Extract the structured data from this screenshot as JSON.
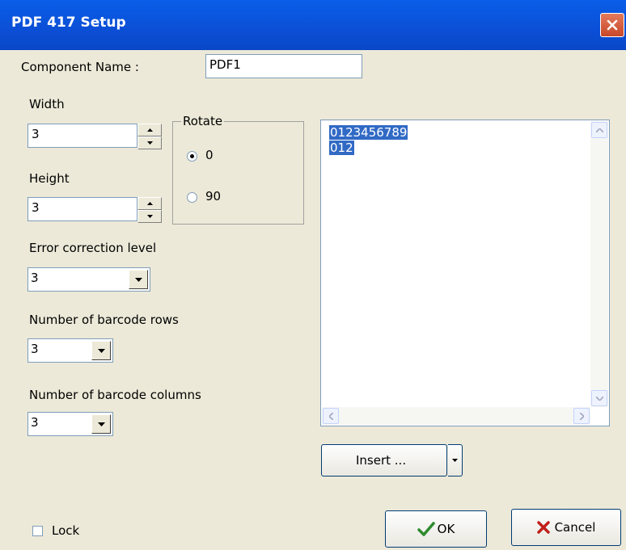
{
  "window": {
    "title": "PDF 417 Setup",
    "close_icon": "close-x-icon"
  },
  "component_name": {
    "label": "Component Name :",
    "value": "PDF1"
  },
  "width": {
    "label": "Width",
    "value": "3"
  },
  "height": {
    "label": "Height",
    "value": "3"
  },
  "rotate": {
    "label": "Rotate",
    "options": [
      {
        "label": "0",
        "selected": true
      },
      {
        "label": "90",
        "selected": false
      }
    ]
  },
  "error_correction": {
    "label": "Error correction level",
    "value": "3"
  },
  "barcode_rows": {
    "label": "Number of barcode rows",
    "value": "3"
  },
  "barcode_columns": {
    "label": "Number of barcode columns",
    "value": "3"
  },
  "memo": {
    "lines": [
      "0123456789",
      "012"
    ]
  },
  "insert_button": {
    "label": "Insert ..."
  },
  "lock": {
    "label": "Lock",
    "checked": false
  },
  "ok_button": {
    "label": "OK",
    "icon": "checkmark-icon"
  },
  "cancel_button": {
    "label": "Cancel",
    "icon": "x-icon"
  },
  "colors": {
    "title_bar": "#0b4fd6",
    "selection": "#316ac5",
    "dialog_bg": "#ece9d8",
    "ok_check": "#2e8b2e",
    "cancel_x": "#c0201c"
  }
}
